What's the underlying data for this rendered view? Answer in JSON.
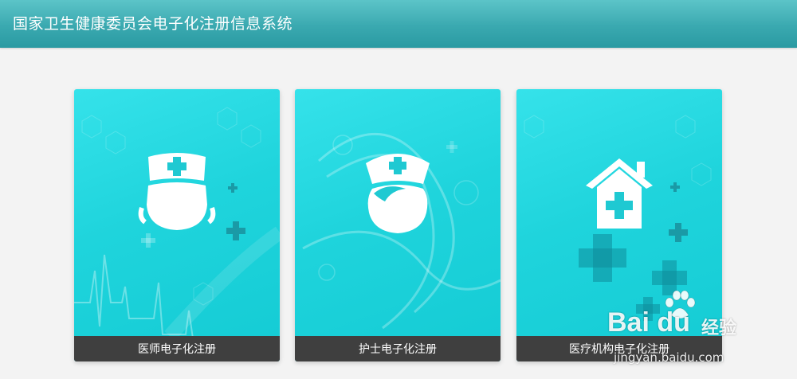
{
  "header": {
    "title": "国家卫生健康委员会电子化注册信息系统"
  },
  "cards": [
    {
      "label": "医师电子化注册",
      "icon": "doctor-icon"
    },
    {
      "label": "护士电子化注册",
      "icon": "nurse-icon"
    },
    {
      "label": "医疗机构电子化注册",
      "icon": "hospital-icon"
    }
  ],
  "watermark": {
    "brand": "Bai du",
    "sub": "经验",
    "url": "jingyan.baidu.com"
  },
  "colors": {
    "header": "#3aa9b0",
    "card": "#1fd4dc",
    "footer": "#3f3f3f",
    "background": "#f3f3f3"
  }
}
